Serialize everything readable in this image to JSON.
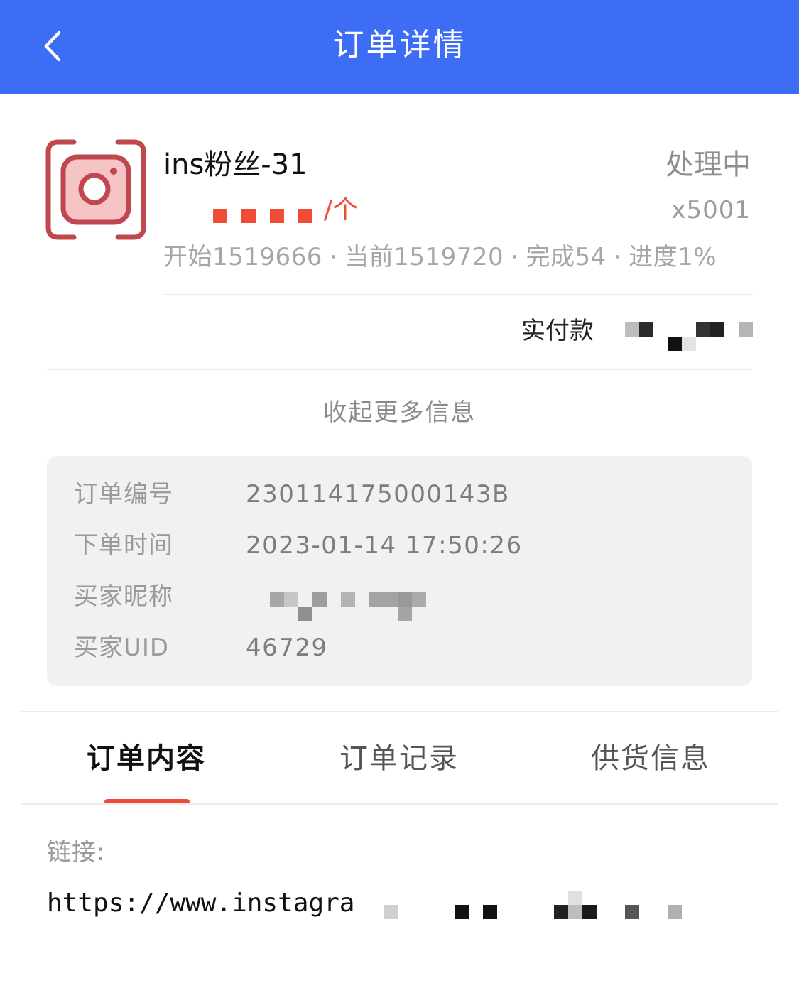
{
  "header": {
    "title": "订单详情"
  },
  "order": {
    "product_name": "ins粉丝-31",
    "status": "处理中",
    "unit": "/个",
    "quantity": "x5001",
    "stats": {
      "start": "开始1519666",
      "current": "当前1519720",
      "completed": "完成54",
      "progress": "进度1%"
    },
    "paid_label": "实付款"
  },
  "collapse_label": "收起更多信息",
  "info": {
    "order_no_label": "订单编号",
    "order_no": "230114175000143B",
    "time_label": "下单时间",
    "time": "2023-01-14 17:50:26",
    "nickname_label": "买家昵称",
    "uid_label": "买家UID",
    "uid": "46729"
  },
  "tabs": [
    {
      "label": "订单内容"
    },
    {
      "label": "订单记录"
    },
    {
      "label": "供货信息"
    }
  ],
  "content": {
    "link_label": "链接:",
    "link_value": "https://www.instagra"
  },
  "colors": {
    "brand": "#3d6df5",
    "accent": "#f04b36",
    "icon": "#c0474f"
  }
}
